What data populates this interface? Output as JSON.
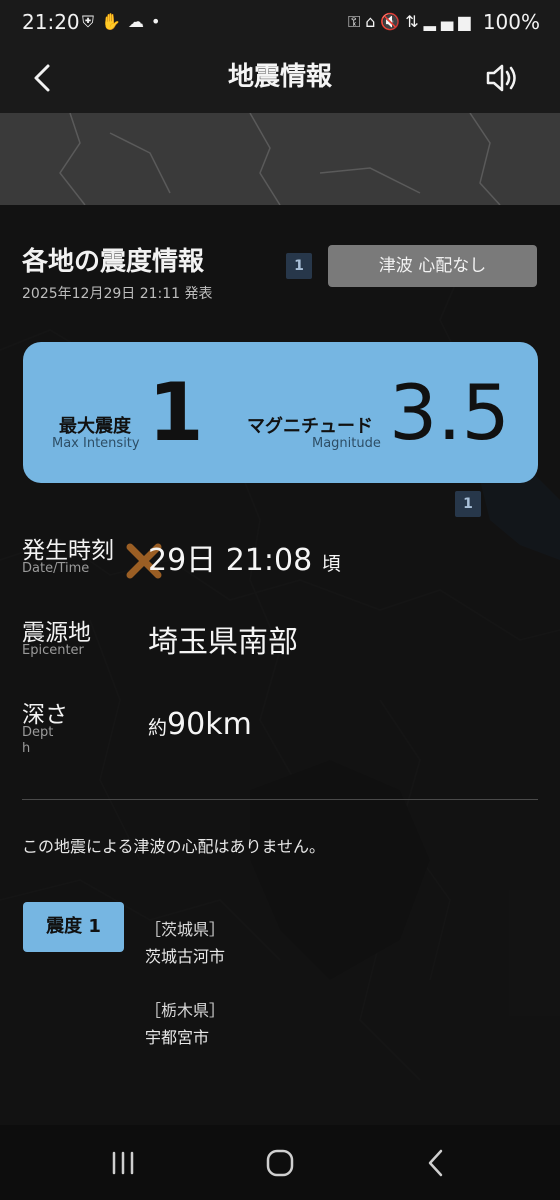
{
  "status_bar": {
    "time": "21:20",
    "left_icons": [
      "shield-icon",
      "hand-icon",
      "cloud-icon",
      "dot-icon"
    ],
    "right_icons": [
      "key-icon",
      "home-icon",
      "mute-icon",
      "4g-icon",
      "signal-icon"
    ],
    "battery": "100%"
  },
  "app_bar": {
    "title": "地震情報",
    "back_icon": "back-arrow-icon",
    "sound_icon": "speaker-icon"
  },
  "panel": {
    "title": "各地の震度情報",
    "issued": "2025年12月29日 21:11 発表",
    "tsunami_chip": "津波 心配なし",
    "map_badge_1": "1",
    "map_badge_2": "1"
  },
  "summary": {
    "max_intensity_label": "最大震度",
    "max_intensity_sub": "Max Intensity",
    "max_intensity_value": "1",
    "magnitude_label": "マグニチュード",
    "magnitude_sub": "Magnitude",
    "magnitude_value": "3.5"
  },
  "details": {
    "datetime_label": "発生時刻",
    "datetime_sub": "Date/Time",
    "datetime_value": "29日 21:08",
    "datetime_suffix": "頃",
    "epicenter_label": "震源地",
    "epicenter_sub": "Epicenter",
    "epicenter_value": "埼玉県南部",
    "depth_label": "深さ",
    "depth_sub_1": "Dept",
    "depth_sub_2": "h",
    "depth_prefix": "約",
    "depth_value": "90km"
  },
  "notice": "この地震による津波の心配はありません。",
  "intensity_list": {
    "badge": "震度 1",
    "groups": [
      {
        "prefecture": "［茨城県］",
        "city": "茨城古河市"
      },
      {
        "prefecture": "［栃木県］",
        "city": "宇都宮市"
      }
    ]
  },
  "colors": {
    "accent": "#76b6e2",
    "chip": "#7a7a7a",
    "background": "#121212"
  }
}
